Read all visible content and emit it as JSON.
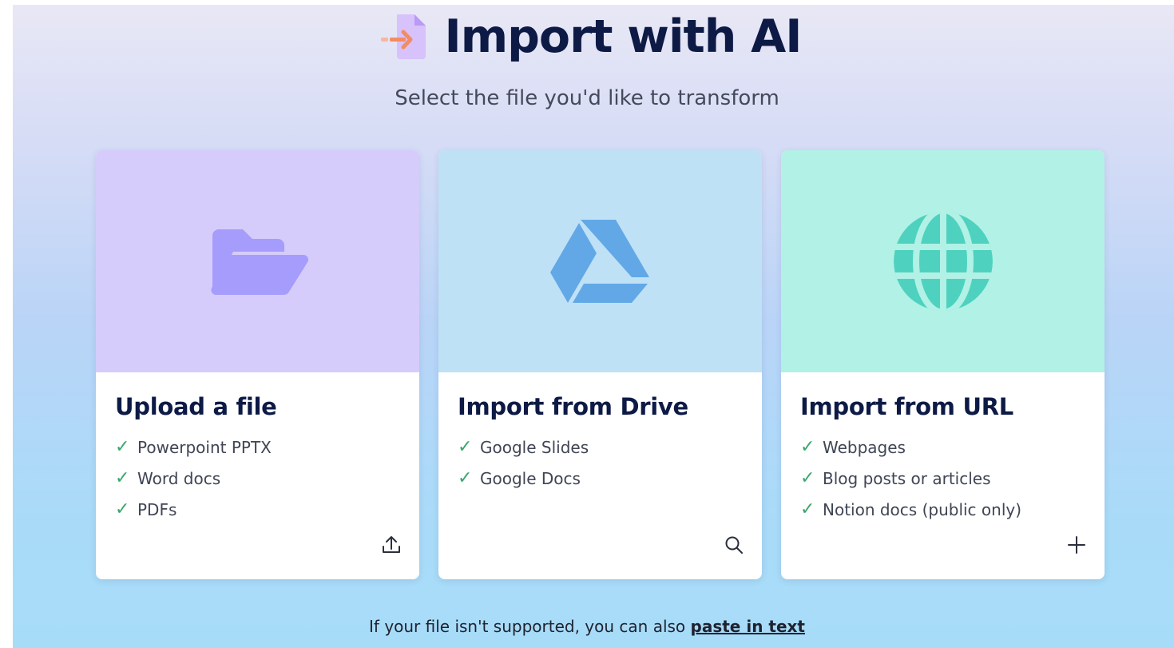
{
  "header": {
    "title": "Import with AI",
    "subtitle": "Select the file you'd like to transform"
  },
  "cards": [
    {
      "title": "Upload a file",
      "top_color": "#d5ccfb",
      "icon": "folder-open-icon",
      "features": [
        "Powerpoint PPTX",
        "Word docs",
        "PDFs"
      ],
      "action_icon": "upload-icon"
    },
    {
      "title": "Import from Drive",
      "top_color": "#bfe1f6",
      "icon": "google-drive-icon",
      "features": [
        "Google Slides",
        "Google Docs"
      ],
      "action_icon": "search-icon"
    },
    {
      "title": "Import from URL",
      "top_color": "#b2f1e5",
      "icon": "globe-icon",
      "features": [
        "Webpages",
        "Blog posts or articles",
        "Notion docs (public only)"
      ],
      "action_icon": "plus-icon"
    }
  ],
  "footer": {
    "text": "If your file isn't supported, you can also ",
    "link": "paste in text"
  },
  "colors": {
    "title": "#0d1a45",
    "check": "#3aa76d",
    "folder": "#a69cfb",
    "drive": "#62a8e6",
    "globe": "#4ed2bf"
  }
}
